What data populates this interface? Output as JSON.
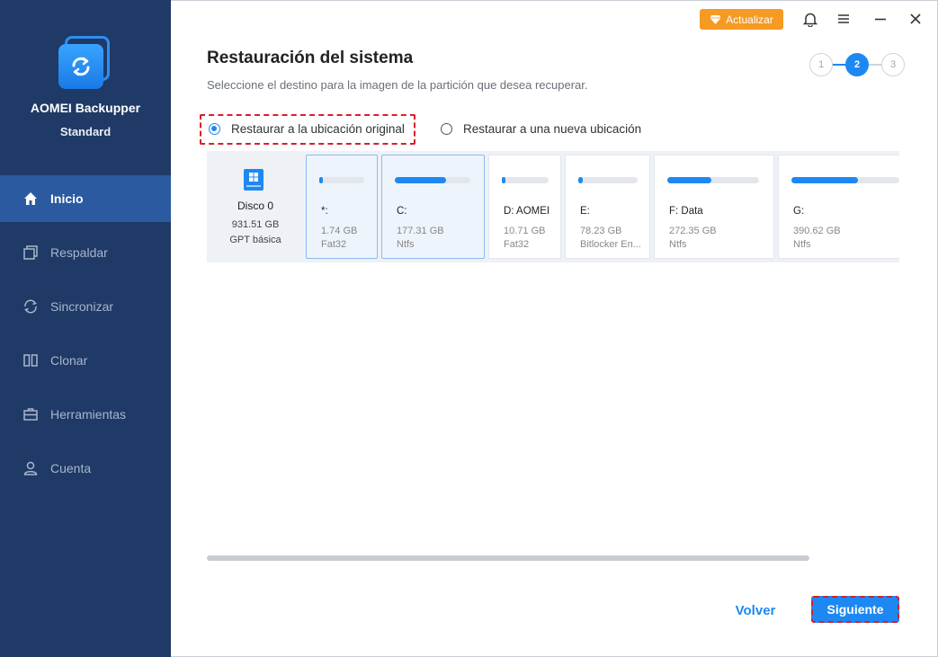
{
  "app": {
    "name": "AOMEI Backupper",
    "edition": "Standard"
  },
  "sidebar": {
    "items": [
      {
        "label": "Inicio",
        "icon": "home-icon",
        "active": true
      },
      {
        "label": "Respaldar",
        "icon": "backup-icon"
      },
      {
        "label": "Sincronizar",
        "icon": "sync-icon"
      },
      {
        "label": "Clonar",
        "icon": "clone-icon"
      },
      {
        "label": "Herramientas",
        "icon": "toolbox-icon"
      },
      {
        "label": "Cuenta",
        "icon": "user-icon"
      }
    ]
  },
  "topbar": {
    "upgrade_label": "Actualizar"
  },
  "page": {
    "title": "Restauración del sistema",
    "subtitle": "Seleccione el destino para la imagen de la partición que desea recuperar.",
    "steps": [
      "1",
      "2",
      "3"
    ],
    "active_step": 2
  },
  "options": {
    "original": "Restaurar a la ubicación original",
    "new": "Restaurar a una nueva ubicación",
    "selected": "original"
  },
  "disk": {
    "name": "Disco 0",
    "size": "931.51 GB",
    "type": "GPT básica"
  },
  "partitions": [
    {
      "name": "*:",
      "size": "1.74 GB",
      "fs": "Fat32",
      "used": 0.05
    },
    {
      "name": "C:",
      "size": "177.31 GB",
      "fs": "Ntfs",
      "used": 0.68
    },
    {
      "name": "D: AOMEI",
      "size": "10.71 GB",
      "fs": "Fat32",
      "used": 0.08
    },
    {
      "name": "E:",
      "size": "78.23 GB",
      "fs": "Bitlocker En...",
      "used": 0.06
    },
    {
      "name": "F: Data",
      "size": "272.35 GB",
      "fs": "Ntfs",
      "used": 0.48
    },
    {
      "name": "G:",
      "size": "390.62 GB",
      "fs": "Ntfs",
      "used": 0.62
    }
  ],
  "buttons": {
    "back": "Volver",
    "next": "Siguiente"
  },
  "colors": {
    "sidebar": "#1f3a66",
    "accent": "#1e88f2",
    "upgrade": "#f59a23",
    "highlight": "#d81e2a"
  }
}
